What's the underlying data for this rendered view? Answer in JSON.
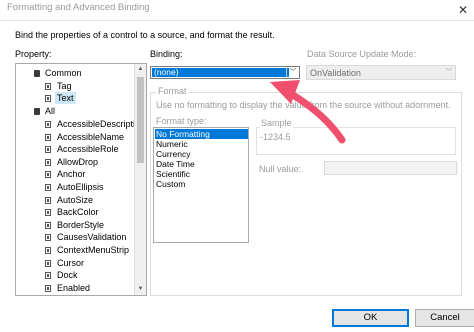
{
  "window": {
    "title": "Formatting and Advanced Binding",
    "description": "Bind the properties of a control to a source, and format the result."
  },
  "property": {
    "label": "Property:",
    "groups": [
      {
        "name": "Common",
        "items": [
          "Tag",
          "Text"
        ]
      },
      {
        "name": "All",
        "items": [
          "AccessibleDescriptio",
          "AccessibleName",
          "AccessibleRole",
          "AllowDrop",
          "Anchor",
          "AutoEllipsis",
          "AutoSize",
          "BackColor",
          "BorderStyle",
          "CausesValidation",
          "ContextMenuStrip",
          "Cursor",
          "Dock",
          "Enabled"
        ]
      }
    ],
    "selected": "Text"
  },
  "binding": {
    "label": "Binding:",
    "value": "(none)"
  },
  "update_mode": {
    "label": "Data Source Update Mode:",
    "value": "OnValidation"
  },
  "format": {
    "legend": "Format",
    "description": "Use no formatting to display the value from the source without adornment.",
    "type_label": "Format type:",
    "types": [
      "No Formatting",
      "Numeric",
      "Currency",
      "Date Time",
      "Scientific",
      "Custom"
    ],
    "selected": "No Formatting",
    "sample_label": "Sample",
    "sample_value": "-1234.5",
    "null_label": "Null value:",
    "null_value": ""
  },
  "buttons": {
    "ok": "OK",
    "cancel": "Cancel"
  },
  "annotation": {
    "arrow_color": "#f0506e"
  }
}
